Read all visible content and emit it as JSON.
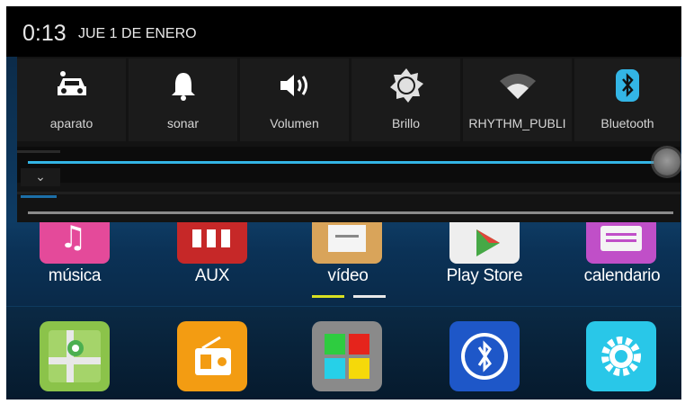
{
  "status_bar": {
    "time": "0:13",
    "date": "JUE 1 DE ENERO"
  },
  "quick_settings": {
    "tiles": [
      {
        "label": "aparato",
        "icon": "car-icon"
      },
      {
        "label": "sonar",
        "icon": "bell-icon"
      },
      {
        "label": "Volumen",
        "icon": "volume-icon"
      },
      {
        "label": "Brillo",
        "icon": "brightness-icon"
      },
      {
        "label": "RHYTHM_PUBLI",
        "icon": "wifi-icon"
      },
      {
        "label": "Bluetooth",
        "icon": "bluetooth-icon"
      }
    ],
    "brightness_level": 0.96,
    "accent": "#33b5e5"
  },
  "launcher": {
    "apps": [
      {
        "label": "música",
        "icon": "music-icon",
        "color": "#e44a9a"
      },
      {
        "label": "AUX",
        "icon": "aux-icon",
        "color": "#c62828"
      },
      {
        "label": "vídeo",
        "icon": "video-icon",
        "color": "#d9a45a"
      },
      {
        "label": "Play Store",
        "icon": "play-store-icon",
        "color": "#eeeeee"
      },
      {
        "label": "calendario",
        "icon": "calendar-icon",
        "color": "#c04fc8"
      }
    ],
    "page_indicator": {
      "pages": 2,
      "current": 1
    }
  },
  "dock": {
    "apps": [
      {
        "icon": "maps-icon",
        "color": "#8bc34a"
      },
      {
        "icon": "radio-icon",
        "color": "#f39c12"
      },
      {
        "icon": "apps-grid-icon",
        "color": "#888888"
      },
      {
        "icon": "bluetooth-app-icon",
        "color": "#1e57c8"
      },
      {
        "icon": "settings-icon",
        "color": "#29c7e8"
      }
    ]
  }
}
